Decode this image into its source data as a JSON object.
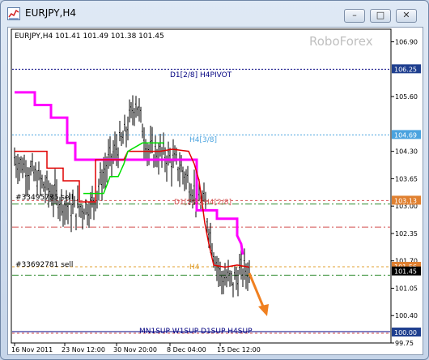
{
  "window": {
    "title": "EURJPY,H4",
    "minimize_glyph": "–",
    "maximize_glyph": "□",
    "close_glyph": "✕"
  },
  "chart": {
    "header": "EURJPY,H4  101.41 101.49 101.38 101.45",
    "watermark": "RoboForex",
    "current_price": "101.45",
    "labels": {
      "pivot": "D1[2/8] H4PIVOT",
      "h4_38": "H4[3/8]",
      "d1_28": "D1[2/8] H4[2/8]",
      "h4": "H4",
      "sell1": "#33495785 sell",
      "sell2": "#33692781 sell",
      "support": "MN1SUP W1SUP D1SUP H4SUP"
    },
    "colors": {
      "magenta": "#ff00ff",
      "red": "#e00000",
      "green": "#00e000",
      "orange_arrow": "#f08020",
      "pivot_line": "#000080",
      "h4_line": "#4aa3df",
      "sell_line": "#d45050",
      "green_line": "#2e8b2e",
      "tag_blue": "#1f3f8f",
      "tag_cyan": "#4aa3df",
      "tag_orange": "#e08030"
    },
    "price_tags": [
      "106.25",
      "104.69",
      "103.13",
      "101.56",
      "101.45",
      "100.00"
    ]
  },
  "chart_data": {
    "type": "candlestick",
    "y_ticks": [
      "106.90",
      "105.60",
      "104.30",
      "103.65",
      "103.00",
      "102.35",
      "101.70",
      "101.05",
      "100.40",
      "99.75"
    ],
    "x_ticks": [
      "16 Nov 2011",
      "23 Nov 12:00",
      "30 Nov 20:00",
      "8 Dec 04:00",
      "15 Dec 12:00"
    ],
    "ylim": [
      99.75,
      107.2
    ],
    "levels": {
      "pivot": 106.25,
      "h4_38": 104.69,
      "sell1": 103.13,
      "green_dashdot_1": 103.05,
      "red_dashdot": 102.5,
      "sell2": 101.56,
      "green_dashdot_2": 101.36,
      "support": 100.0
    }
  }
}
